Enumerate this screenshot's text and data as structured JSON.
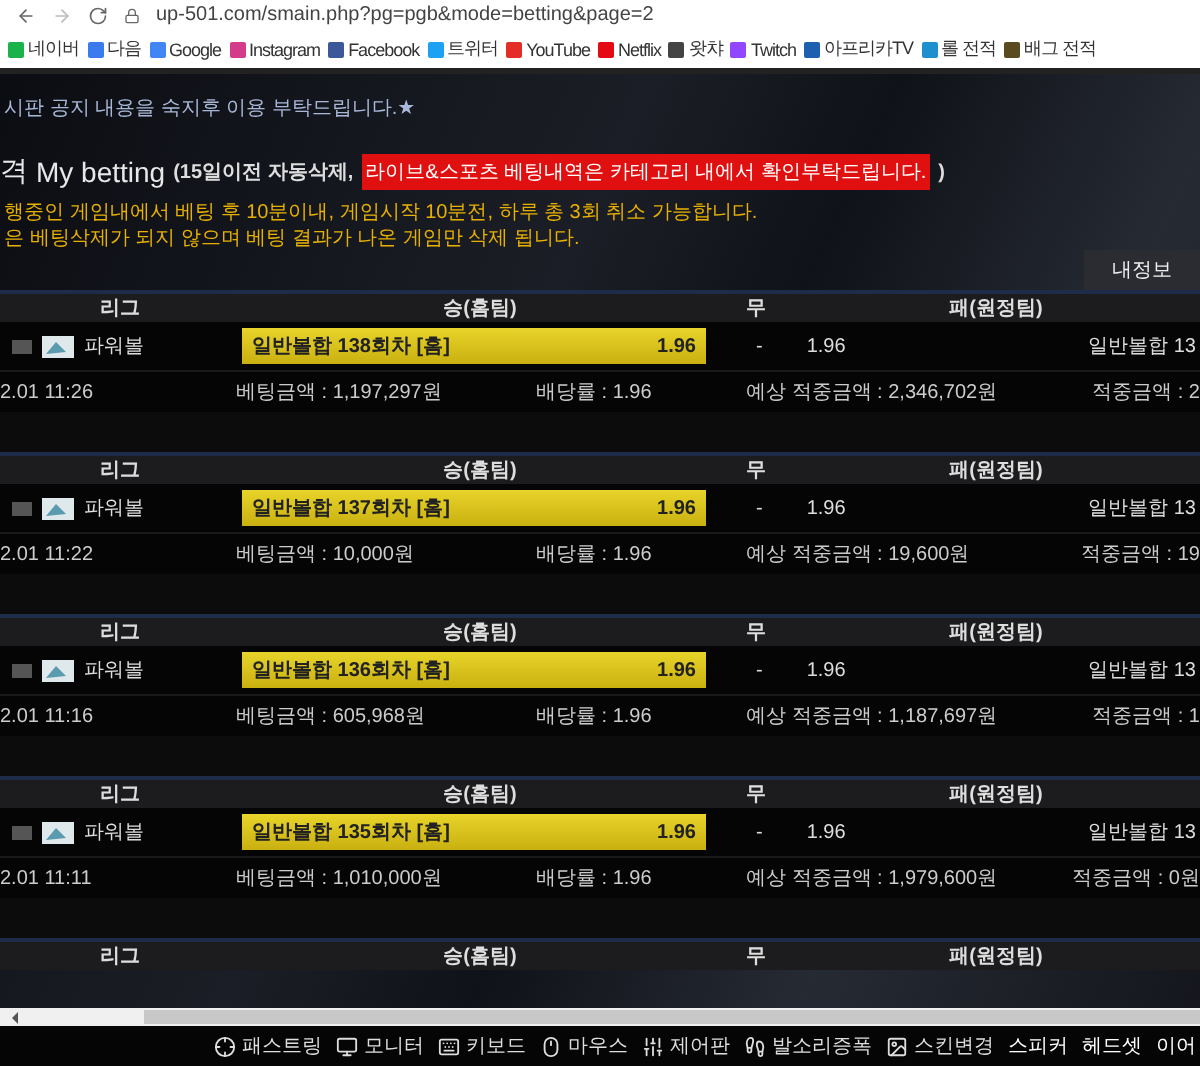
{
  "browser": {
    "url": "up-501.com/smain.php?pg=pgb&mode=betting&page=2",
    "bookmarks": [
      {
        "label": "네이버"
      },
      {
        "label": "다음"
      },
      {
        "label": "Google"
      },
      {
        "label": "Instagram"
      },
      {
        "label": "Facebook"
      },
      {
        "label": "트위터"
      },
      {
        "label": "YouTube"
      },
      {
        "label": "Netflix"
      },
      {
        "label": "왓챠"
      },
      {
        "label": "Twitch"
      },
      {
        "label": "아프리카TV"
      },
      {
        "label": "롤 전적"
      },
      {
        "label": "배그 전적"
      }
    ]
  },
  "notice": "시판 공지 내용을 숙지후 이용 부탁드립니다.★",
  "title": {
    "prefix": "격",
    "main": "My betting",
    "note": "(15일이전 자동삭제,",
    "highlight": "라이브&스포츠 베팅내역은 카테고리 내에서 확인부탁드립니다.",
    "close": ")"
  },
  "rules": [
    "행중인 게임내에서 베팅 후 10분이내, 게임시작 10분전, 하루 총 3회 취소 가능합니다.",
    "은 베팅삭제가 되지 않으며 베팅 결과가 나온 게임만 삭제 됩니다."
  ],
  "my_info_button": "내정보",
  "bets": [
    {
      "header": [
        "리그",
        "승(홈팀)",
        "무",
        "패(원정팀)"
      ],
      "league": "파워볼",
      "home_pick": "일반볼합 138회차 [홈]",
      "home_odds": "1.96",
      "home_selected": true,
      "draw": "-",
      "draw_odds": "1.96",
      "away_pick": "일반볼합 13",
      "time": "2.01 11:26",
      "stake": "베팅금액 : 1,197,297원",
      "rate": "배당률 : 1.96",
      "expected": "예상 적중금액 : 2,346,702원",
      "won": "적중금액 : 2"
    },
    {
      "header": [
        "리그",
        "승(홈팀)",
        "무",
        "패(원정팀)"
      ],
      "league": "파워볼",
      "home_pick": "일반볼합 137회차 [홈]",
      "home_odds": "1.96",
      "home_selected": true,
      "draw": "-",
      "draw_odds": "1.96",
      "away_pick": "일반볼합 13",
      "time": "2.01 11:22",
      "stake": "베팅금액 : 10,000원",
      "rate": "배당률 : 1.96",
      "expected": "예상 적중금액 : 19,600원",
      "won": "적중금액 : 19"
    },
    {
      "header": [
        "리그",
        "승(홈팀)",
        "무",
        "패(원정팀)"
      ],
      "league": "파워볼",
      "home_pick": "일반볼합 136회차 [홈]",
      "home_odds": "1.96",
      "home_selected": true,
      "draw": "-",
      "draw_odds": "1.96",
      "away_pick": "일반볼합 13",
      "time": "2.01 11:16",
      "stake": "베팅금액 : 605,968원",
      "rate": "배당률 : 1.96",
      "expected": "예상 적중금액 : 1,187,697원",
      "won": "적중금액 : 1"
    },
    {
      "header": [
        "리그",
        "승(홈팀)",
        "무",
        "패(원정팀)"
      ],
      "league": "파워볼",
      "home_pick": "일반볼합 135회차 [홈]",
      "home_odds": "1.96",
      "home_selected": true,
      "draw": "-",
      "draw_odds": "1.96",
      "away_pick": "일반볼합 13",
      "time": "2.01 11:11",
      "stake": "베팅금액 : 1,010,000원",
      "rate": "배당률 : 1.96",
      "expected": "예상 적중금액 : 1,979,600원",
      "won": "적중금액 : 0원"
    }
  ],
  "last_header": [
    "리그",
    "승(홈팀)",
    "무",
    "패(원정팀)"
  ],
  "taskbar": {
    "tools": [
      {
        "label": "패스트링"
      },
      {
        "label": "모니터"
      },
      {
        "label": "키보드"
      },
      {
        "label": "마우스"
      },
      {
        "label": "제어판"
      },
      {
        "label": "발소리증폭"
      },
      {
        "label": "스킨변경"
      }
    ],
    "audio_tabs": [
      {
        "label": "스피커"
      },
      {
        "label": "헤드셋"
      },
      {
        "label": "이어"
      }
    ]
  }
}
